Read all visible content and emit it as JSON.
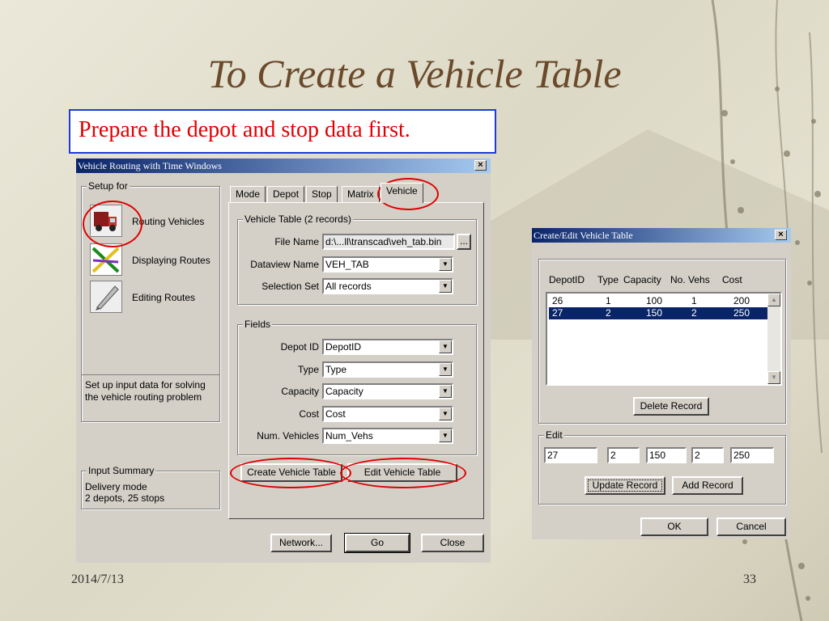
{
  "slide": {
    "title": "To Create a Vehicle Table",
    "callout": "Prepare the depot and stop data first.",
    "date": "2014/7/13",
    "page_number": "33"
  },
  "vrtw": {
    "title": "Vehicle Routing with Time Windows",
    "close": "×",
    "setup_for": {
      "label": "Setup for",
      "items": [
        {
          "label": "Routing Vehicles",
          "icon": "truck-icon"
        },
        {
          "label": "Displaying Routes",
          "icon": "routes-icon"
        },
        {
          "label": "Editing Routes",
          "icon": "pen-icon"
        }
      ],
      "description": "Set up input data for solving the vehicle routing problem"
    },
    "input_summary": {
      "label": "Input Summary",
      "line1": "Delivery mode",
      "line2": "2 depots, 25 stops"
    },
    "tabs": [
      "Mode",
      "Depot",
      "Stop",
      "Matrix",
      "Vehicle"
    ],
    "active_tab": "Vehicle",
    "vehicle_table": {
      "label": "Vehicle Table (2 records)",
      "file_name_label": "File Name",
      "file_name": "d:\\...ll\\transcad\\veh_tab.bin",
      "browse": "...",
      "dataview_label": "Dataview Name",
      "dataview": "VEH_TAB",
      "selection_label": "Selection Set",
      "selection": "All records"
    },
    "fields": {
      "label": "Fields",
      "depot_id_label": "Depot ID",
      "depot_id": "DepotID",
      "type_label": "Type",
      "type": "Type",
      "capacity_label": "Capacity",
      "capacity": "Capacity",
      "cost_label": "Cost",
      "cost": "Cost",
      "num_vehicles_label": "Num. Vehicles",
      "num_vehicles": "Num_Vehs"
    },
    "create_button": "Create Vehicle Table",
    "edit_button": "Edit Vehicle Table",
    "network_button": "Network...",
    "go_button": "Go",
    "close_button": "Close"
  },
  "cevt": {
    "title": "Create/Edit Vehicle Table",
    "close": "×",
    "columns": [
      "DepotID",
      "Type",
      "Capacity",
      "No. Vehs",
      "Cost"
    ],
    "rows": [
      [
        "26",
        "1",
        "100",
        "1",
        "200"
      ],
      [
        "27",
        "2",
        "150",
        "2",
        "250"
      ]
    ],
    "selected_row": 1,
    "delete_button": "Delete Record",
    "edit_label": "Edit",
    "edit_values": [
      "27",
      "2",
      "150",
      "2",
      "250"
    ],
    "update_button": "Update Record",
    "add_button": "Add Record",
    "ok_button": "OK",
    "cancel_button": "Cancel"
  },
  "colors": {
    "title": "#6b4a2b",
    "callout_text": "#e00000",
    "callout_border": "#1f3bd6",
    "highlight": "#e00000",
    "win_title": "#0a246a"
  }
}
